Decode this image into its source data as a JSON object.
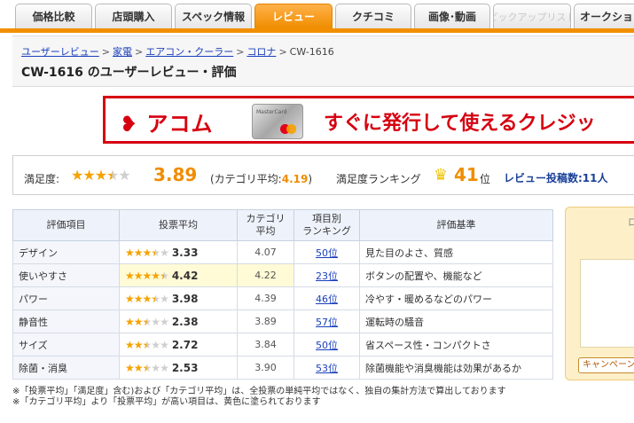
{
  "tabs": [
    {
      "label": "価格比較",
      "state": "normal"
    },
    {
      "label": "店頭購入",
      "state": "normal"
    },
    {
      "label": "スペック情報",
      "state": "normal"
    },
    {
      "label": "レビュー",
      "state": "active"
    },
    {
      "label": "クチコミ",
      "state": "normal"
    },
    {
      "label": "画像･動画",
      "state": "normal"
    },
    {
      "label": "ピックアップリスト",
      "state": "disabled"
    },
    {
      "label": "オークショ",
      "state": "normal"
    }
  ],
  "breadcrumb": {
    "items": [
      "ユーザーレビュー",
      "家電",
      "エアコン・クーラー",
      "コロナ"
    ],
    "current": "CW-1616",
    "separator": ">"
  },
  "page_title": "CW-1616 のユーザーレビュー・評価",
  "banner": {
    "logo": "アコム",
    "card_text": "MasterCard",
    "copy": "すぐに発行して使えるクレジッ"
  },
  "summary": {
    "satisfaction_label": "満足度:",
    "stars": 3.89,
    "score": "3.89",
    "category_avg_label": "(カテゴリ平均:",
    "category_avg_value": "4.19",
    "category_avg_close": ")",
    "ranking_label": "満足度ランキング",
    "rank_value": "41",
    "rank_unit": "位",
    "review_count": "レビュー投稿数:11人"
  },
  "table": {
    "headers": [
      "評価項目",
      "投票平均",
      "カテゴリ\n平均",
      "項目別\nランキング",
      "評価基準"
    ],
    "rows": [
      {
        "item": "デザイン",
        "stars": 3.33,
        "avg": "3.33",
        "cat": "4.07",
        "rank": "50位",
        "criteria": "見た目のよさ、質感",
        "highlight": false
      },
      {
        "item": "使いやすさ",
        "stars": 4.42,
        "avg": "4.42",
        "cat": "4.22",
        "rank": "23位",
        "criteria": "ボタンの配置や、機能など",
        "highlight": true
      },
      {
        "item": "パワー",
        "stars": 3.98,
        "avg": "3.98",
        "cat": "4.39",
        "rank": "46位",
        "criteria": "冷やす・暖めるなどのパワー",
        "highlight": false
      },
      {
        "item": "静音性",
        "stars": 2.38,
        "avg": "2.38",
        "cat": "3.89",
        "rank": "57位",
        "criteria": "運転時の騒音",
        "highlight": false
      },
      {
        "item": "サイズ",
        "stars": 2.72,
        "avg": "2.72",
        "cat": "3.84",
        "rank": "50位",
        "criteria": "省スペース性・コンパクトさ",
        "highlight": false
      },
      {
        "item": "除菌・消臭",
        "stars": 2.53,
        "avg": "2.53",
        "cat": "3.90",
        "rank": "53位",
        "criteria": "除菌機能や消臭機能は効果があるか",
        "highlight": false
      }
    ]
  },
  "notes": [
    "※「投票平均」「満足度」含む)および「カテゴリ平均」は、全投票の単純平均ではなく、独自の集計方法で算出しております",
    "※「カテゴリ平均」より「投票平均」が高い項目は、黄色に塗られております"
  ],
  "side": {
    "head": "ロ",
    "campaign": "キャンペーン"
  },
  "colors": {
    "accent": "#f18f00",
    "star": "#f5a300",
    "link": "#1a3fbb",
    "banner_red": "#d60010",
    "highlight": "#fffbd6"
  }
}
